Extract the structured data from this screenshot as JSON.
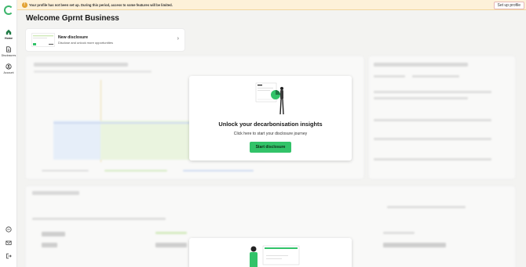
{
  "sidebar": {
    "items": [
      {
        "label": "Home",
        "icon": "home-icon"
      },
      {
        "label": "Disclosures",
        "icon": "document-icon"
      },
      {
        "label": "Account",
        "icon": "user-icon"
      }
    ],
    "bottom_icons": [
      "help-icon",
      "mail-icon",
      "logout-icon"
    ]
  },
  "banner": {
    "text": "Your profile has not been set up. During this period, access to some features will be limited.",
    "button_label": "Set up profile"
  },
  "page_title": "Welcome Gprnt Business",
  "disclosure_card": {
    "title": "New disclosure",
    "subtitle": "Disclose and unlock more opportunities"
  },
  "modal": {
    "title": "Unlock your decarbonisation insights",
    "subtitle": "Click here to start your disclosure journey",
    "button_label": "Start disclosure"
  },
  "colors": {
    "accent": "#32c369",
    "banner_bg": "#fdf1d9",
    "warning": "#e3a233"
  }
}
